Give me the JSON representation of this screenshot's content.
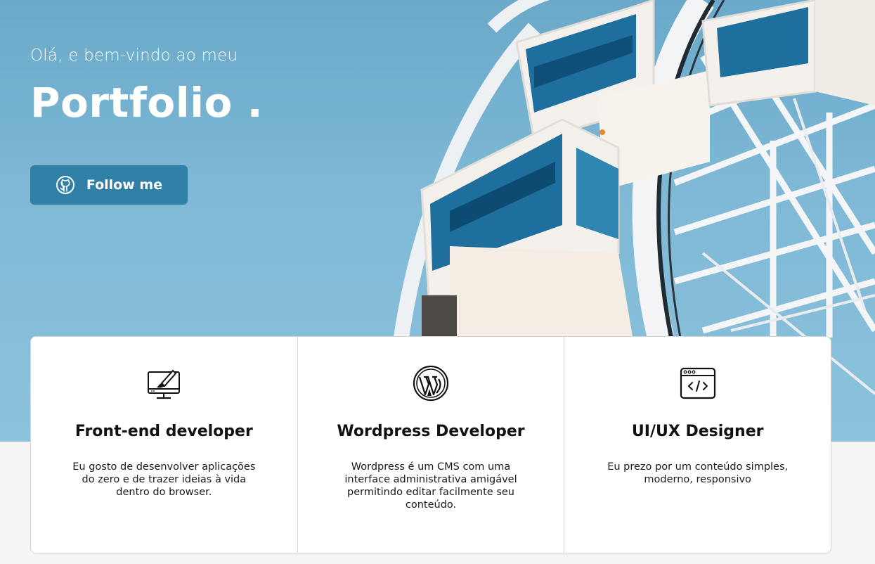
{
  "hero": {
    "greeting": "Olá, e bem-vindo ao meu",
    "title": "Portfolio .",
    "follow_label": "Follow me",
    "follow_icon": "github-icon",
    "accent_color": "#2f7fa6"
  },
  "services": [
    {
      "icon": "monitor-brush-icon",
      "title": "Front-end developer",
      "description": "Eu gosto de desenvolver aplicações do zero e de trazer ideias à vida dentro do browser."
    },
    {
      "icon": "wordpress-icon",
      "title": "Wordpress Developer",
      "description": "Wordpress é um CMS com uma interface administrativa amigável permitindo editar facilmente seu conteúdo."
    },
    {
      "icon": "code-window-icon",
      "title": "UI/UX Designer",
      "description": "Eu prezo por um conteúdo simples, moderno, responsivo"
    }
  ]
}
